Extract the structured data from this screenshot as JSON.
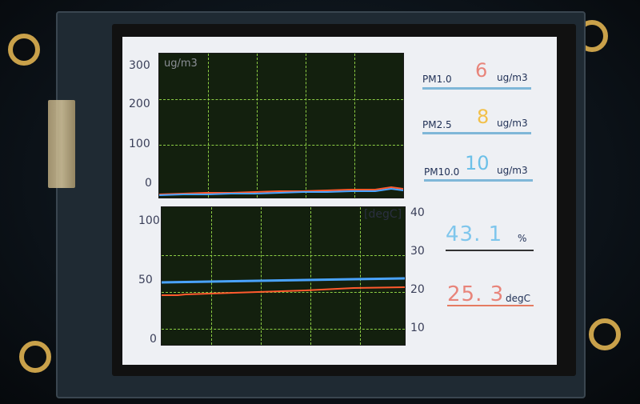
{
  "pm_chart": {
    "unit_label": "ug/m3",
    "y_ticks": [
      "300",
      "200",
      "100",
      "0"
    ]
  },
  "env_chart": {
    "unit_label": "[degC]",
    "y_ticks_left": [
      "100",
      "50",
      "0"
    ],
    "y_ticks_right": [
      "40",
      "30",
      "20",
      "10"
    ]
  },
  "readouts": {
    "pm1": {
      "label": "PM1.0",
      "value": "6",
      "unit": "ug/m3",
      "color": "#e8847a"
    },
    "pm25": {
      "label": "PM2.5",
      "value": "8",
      "unit": "ug/m3",
      "color": "#f2c04a"
    },
    "pm10": {
      "label": "PM10.0",
      "value": "10",
      "unit": "ug/m3",
      "color": "#6cc0e8"
    },
    "humidity": {
      "value": "43. 1",
      "unit": "%",
      "color": "#7fc6ec"
    },
    "temperature": {
      "value": "25. 3",
      "unit": "degC",
      "color": "#e8847a"
    }
  },
  "colors": {
    "humidity_line": "#4aa3ff",
    "temperature_line": "#ff5a2e",
    "pm_line_a": "#ff5a2e",
    "pm_line_b": "#4aa3ff",
    "grid": "#9be14a"
  }
}
